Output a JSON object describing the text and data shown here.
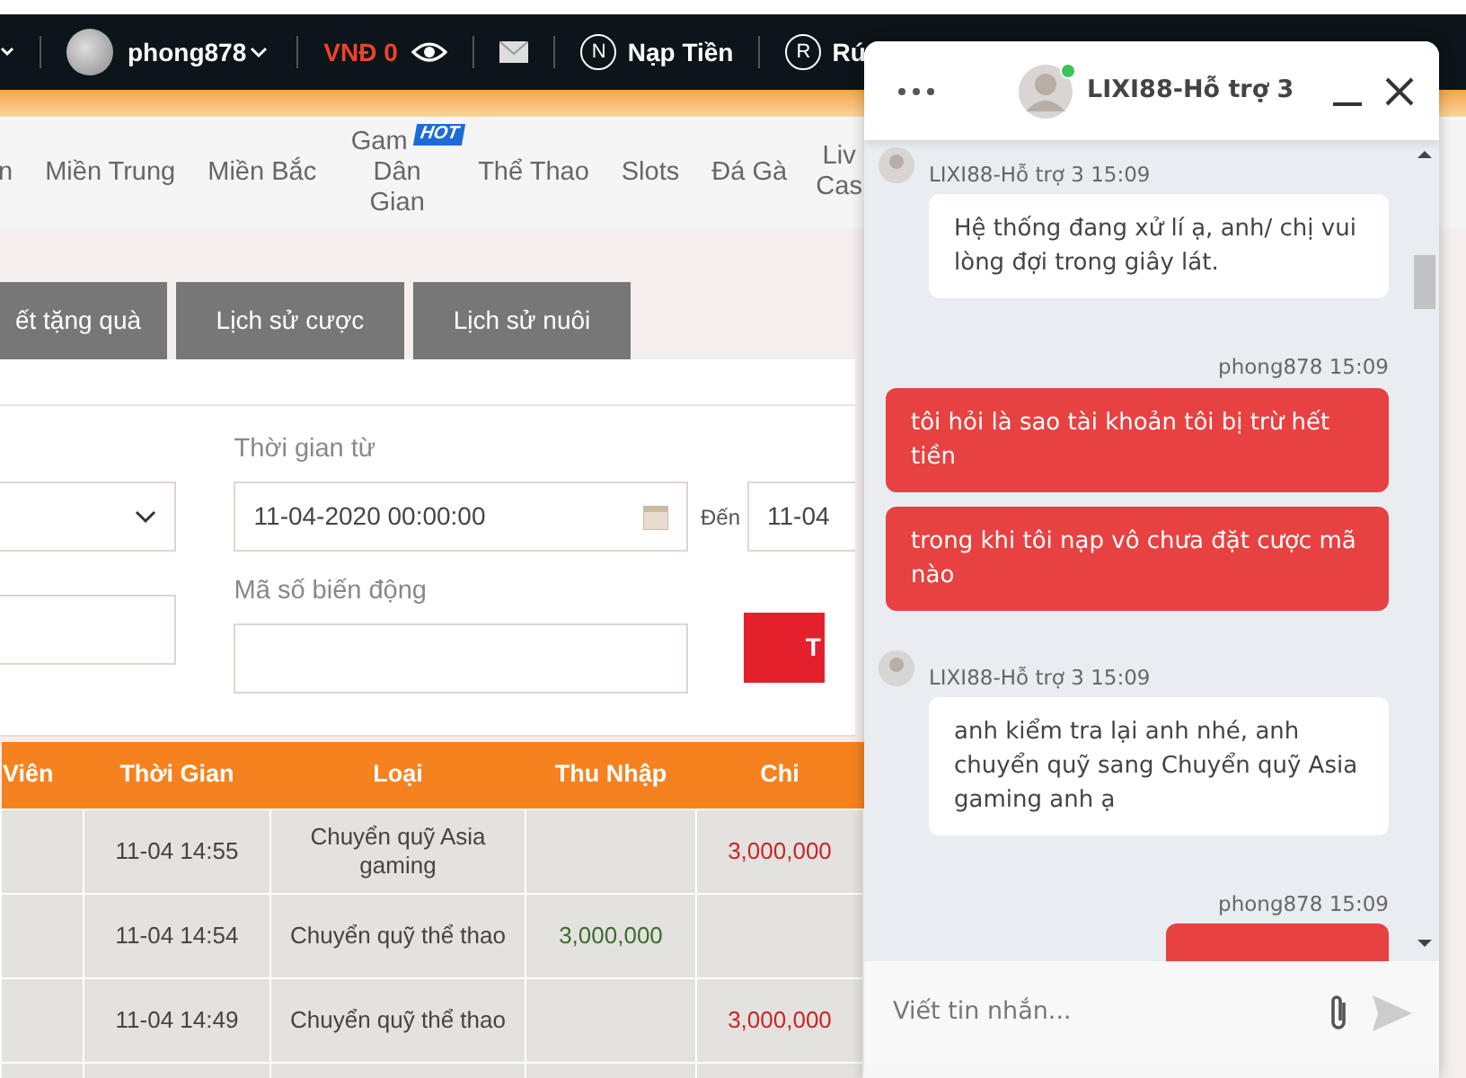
{
  "top_bar": {
    "username": "phong878",
    "balance": "VNĐ 0",
    "actions": [
      {
        "icon": "N",
        "label": "Nạp Tiền"
      },
      {
        "icon": "R",
        "label": "Rú"
      }
    ]
  },
  "nav": {
    "items": [
      {
        "label": "n"
      },
      {
        "label": "Miền Trung"
      },
      {
        "label": "Miền Bắc"
      },
      {
        "label": "Gam",
        "badge": "HOT",
        "sublabel": "Dân Gian"
      },
      {
        "label": "Thể Thao"
      },
      {
        "label": "Slots"
      },
      {
        "label": "Đá Gà"
      },
      {
        "label": "Liv",
        "sublabel": "Cas"
      }
    ]
  },
  "tabs": [
    {
      "label": "ết tặng quà",
      "selected": false
    },
    {
      "label": "Lịch sử cược",
      "selected": false
    },
    {
      "label": "Lịch sử nuôi",
      "selected": false
    }
  ],
  "filters": {
    "from_label": "Thời gian từ",
    "from_value": "11-04-2020 00:00:00",
    "to_label": "Đến",
    "to_value": "11-04",
    "code_label": "Mã số biến động",
    "button": "T"
  },
  "table": {
    "columns": [
      "Viên",
      "Thời Gian",
      "Loại",
      "Thu Nhập",
      "Chi"
    ],
    "rows": [
      {
        "time": "11-04 14:55",
        "type": "Chuyển quỹ Asia gaming",
        "chi": "3,000,000"
      },
      {
        "time": "11-04 14:54",
        "type": "Chuyển quỹ thể thao",
        "income": "3,000,000"
      },
      {
        "time": "11-04 14:49",
        "type": "Chuyển quỹ thể thao",
        "chi": "3,000,000"
      }
    ]
  },
  "chat": {
    "title": "LIXI88-Hỗ trợ 3",
    "online": true,
    "messages": [
      {
        "kind": "agent",
        "meta": "LIXI88-Hỗ trợ 3 15:09",
        "text": "Hệ thống đang xử lí ạ, anh/ chị vui lòng đợi trong giây lát."
      },
      {
        "kind": "user",
        "meta": "phong878 15:09",
        "text": "tôi hỏi là sao tài khoản tôi bị trừ hết tiền"
      },
      {
        "kind": "user",
        "text": "trong khi tôi nạp vô chưa đặt cược mã nào"
      },
      {
        "kind": "agent",
        "meta": "LIXI88-Hỗ trợ 3 15:09",
        "text": "anh kiểm tra lại anh nhé, anh chuyển quỹ sang Chuyển quỹ Asia gaming anh ạ"
      },
      {
        "kind": "user",
        "meta": "phong878 15:09"
      }
    ],
    "input": {
      "placeholder": "Viết tin nhắn..."
    }
  }
}
